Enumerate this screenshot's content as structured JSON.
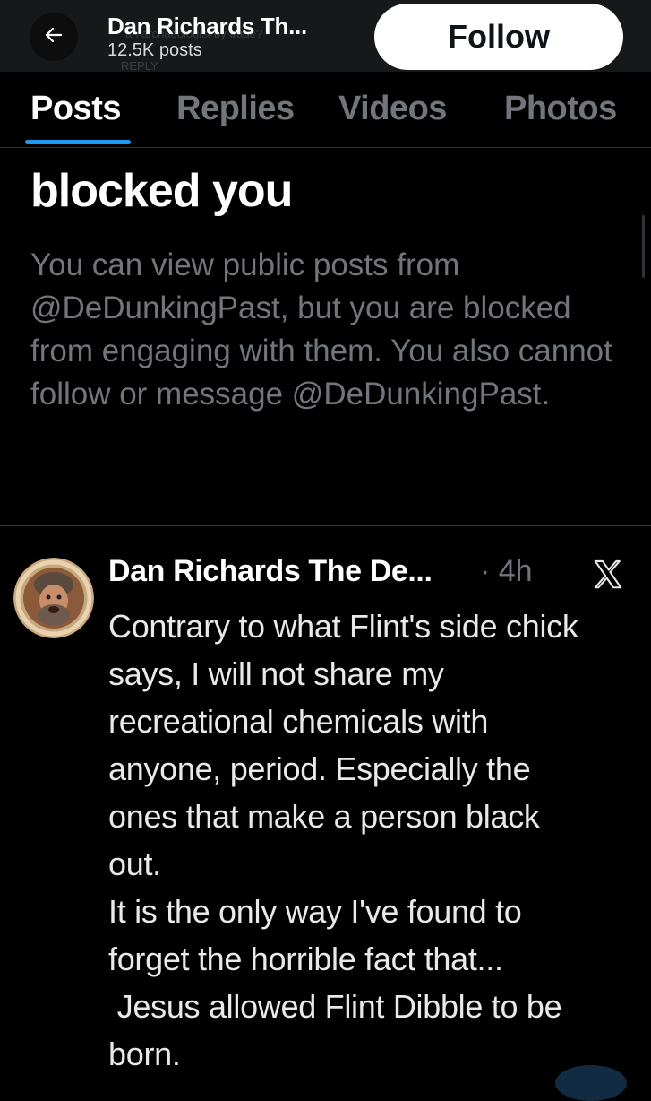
{
  "header": {
    "back_icon": "arrow-left-icon",
    "name": "Dan Richards Th...",
    "posts_count": "12.5K posts",
    "follow_label": "Follow",
    "ghost_text_1": "an archaeologist by trade?",
    "ghost_text_2": "REPLY"
  },
  "tabs": [
    {
      "label": "Posts",
      "active": true
    },
    {
      "label": "Replies",
      "active": false
    },
    {
      "label": "Videos",
      "active": false
    },
    {
      "label": "Photos",
      "active": false
    }
  ],
  "blocked_notice": {
    "title": "blocked you",
    "message": "You can view public posts from @DeDunkingPast, but you are blocked from engaging with them. You also cannot follow or message @DeDunkingPast."
  },
  "post": {
    "author": "Dan Richards The De...",
    "time": "· 4h",
    "logo_icon": "x-logo-icon",
    "lines": [
      "Contrary to what Flint's side chick",
      "says, I will not share my",
      "recreational chemicals with",
      "anyone, period. Especially the",
      "ones that make a person black",
      "out.",
      "It is the only way I've found to",
      "forget the horrible fact that...",
      " Jesus allowed Flint Dibble to be",
      "born."
    ]
  },
  "colors": {
    "background": "#000000",
    "accent": "#1d9bf0",
    "muted": "#71767b",
    "text": "#e7e9ea"
  }
}
